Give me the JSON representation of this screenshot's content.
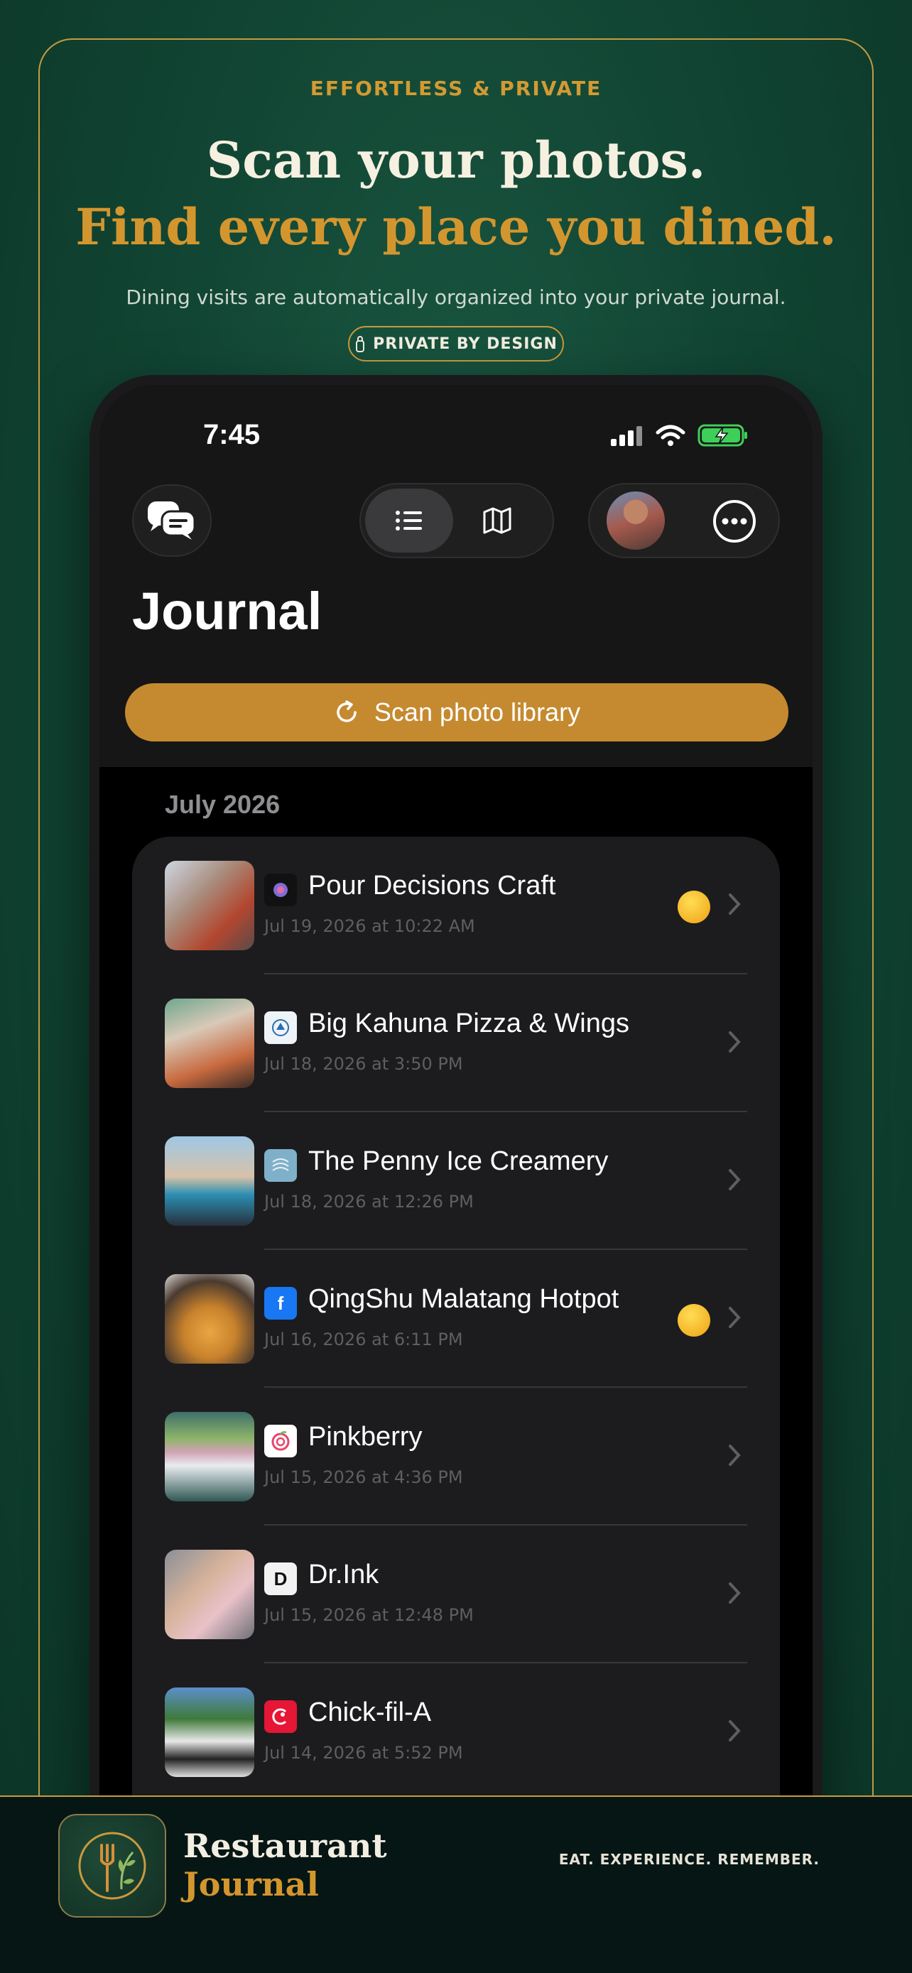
{
  "promo": {
    "eyebrow": "EFFORTLESS & PRIVATE",
    "headline_line1": "Scan your photos.",
    "headline_line2": "Find every place you dined.",
    "subtitle": "Dining visits are automatically organized into your private journal.",
    "badge": "PRIVATE BY DESIGN"
  },
  "status_bar": {
    "time": "7:45"
  },
  "toolbar": {
    "chat_icon": "chat-bubbles-icon",
    "list_icon": "list-icon",
    "map_icon": "map-icon",
    "more_icon": "ellipsis-circle-icon"
  },
  "page": {
    "title": "Journal",
    "scan_button": "Scan photo library",
    "month": "July 2026"
  },
  "entries": [
    {
      "name": "Pour Decisions Craft",
      "date": "Jul 19, 2026 at 10:22 AM",
      "has_emoji": true
    },
    {
      "name": "Big Kahuna Pizza & Wings",
      "date": "Jul 18, 2026 at 3:50 PM",
      "has_emoji": false
    },
    {
      "name": "The Penny Ice Creamery",
      "date": "Jul 18, 2026 at 12:26 PM",
      "has_emoji": false
    },
    {
      "name": "QingShu Malatang Hotpot",
      "date": "Jul 16, 2026 at 6:11 PM",
      "has_emoji": true
    },
    {
      "name": "Pinkberry",
      "date": "Jul 15, 2026 at 4:36 PM",
      "has_emoji": false
    },
    {
      "name": "Dr.Ink",
      "date": "Jul 15, 2026 at 12:48 PM",
      "has_emoji": false
    },
    {
      "name": "Chick-fil-A",
      "date": "Jul 14, 2026 at 5:52 PM",
      "has_emoji": false
    }
  ],
  "logos": {
    "facebook": "f",
    "drink": "D"
  },
  "footer": {
    "brand_line1": "Restaurant",
    "brand_line2": "Journal",
    "tagline": "EAT. EXPERIENCE. REMEMBER."
  },
  "colors": {
    "accent_gold": "#c58a30",
    "background_green": "#124634",
    "card": "#1c1c1e"
  }
}
